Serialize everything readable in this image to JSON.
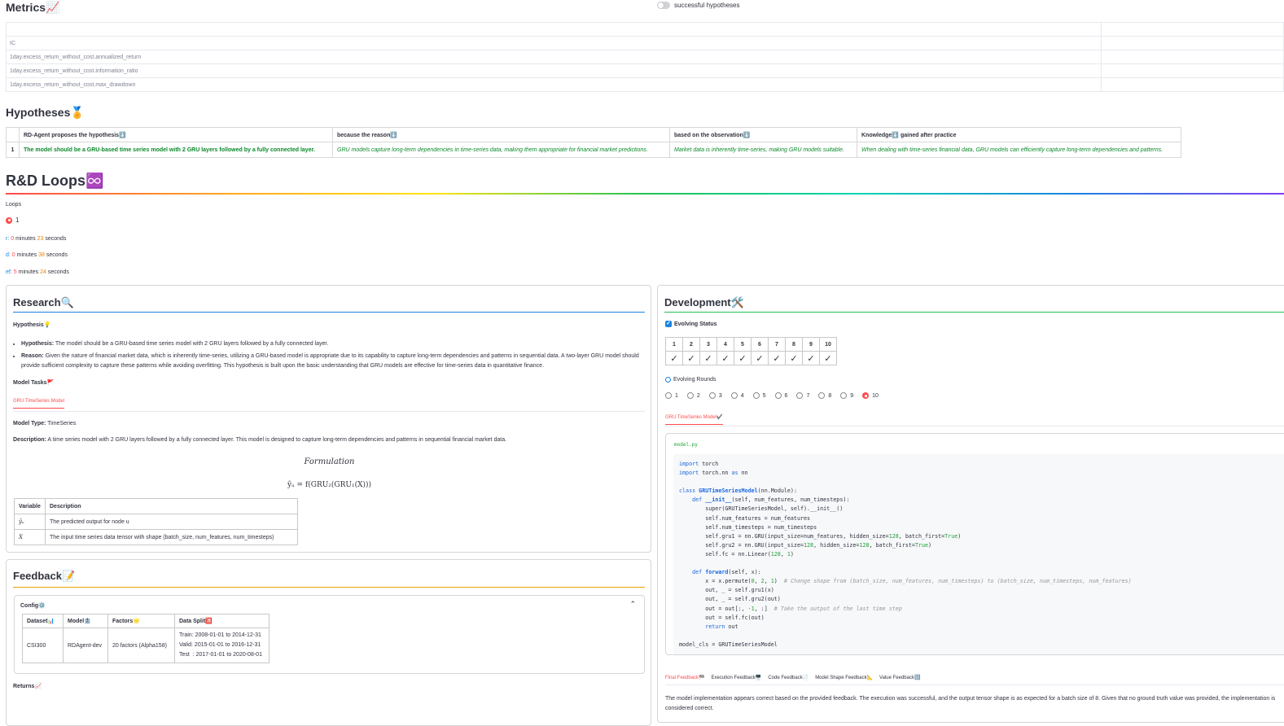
{
  "metrics": {
    "title": "Metrics📈",
    "toggle_label": "successful hypotheses",
    "rows": [
      "",
      "IC",
      "1day.excess_return_without_cost.annualized_return",
      "1day.excess_return_without_cost.information_ratio",
      "1day.excess_return_without_cost.max_drawdown"
    ]
  },
  "hypotheses": {
    "title": "Hypotheses🏅",
    "headers": [
      "",
      "RD-Agent proposes the hypothesis⬇️",
      "because the reason⬇️",
      "based on the observation⬇️",
      "Knowledge⬇️ gained after practice"
    ],
    "row": {
      "index": "1",
      "hypothesis": "The model should be a GRU-based time series model with 2 GRU layers followed by a fully connected layer.",
      "reason": "GRU models capture long-term dependencies in time-series data, making them appropriate for financial market predictions.",
      "observation": "Market data is inherently time-series, making GRU models suitable.",
      "knowledge": "When dealing with time-series financial data, GRU models can efficiently capture long-term dependencies and patterns."
    }
  },
  "rd": {
    "title": "R&D Loops♾️",
    "loops_label": "Loops",
    "loop_value": "1",
    "timings": [
      {
        "key": "r:",
        "min": "0",
        "sec": "23"
      },
      {
        "key": "d:",
        "min": "0",
        "sec": "38"
      },
      {
        "key": "ef:",
        "min": "5",
        "sec": "24"
      }
    ],
    "minutes_word": "minutes",
    "seconds_word": "seconds"
  },
  "research": {
    "title": "Research🔍",
    "hypothesis_label": "Hypothesis💡",
    "bullet1_key": "Hypothesis:",
    "bullet1_text": "The model should be a GRU-based time series model with 2 GRU layers followed by a fully connected layer.",
    "bullet2_key": "Reason:",
    "bullet2_text": "Given the nature of financial market data, which is inherently time-series, utilizing a GRU-based model is appropriate due to its capability to capture long-term dependencies and patterns in sequential data. A two-layer GRU model should provide sufficient complexity to capture these patterns while avoiding overfitting. This hypothesis is built upon the basic understanding that GRU models are effective for time-series data in quantitative finance.",
    "tasks_label": "Model Tasks🚩",
    "task_tab": "GRU TimeSeries Model",
    "model_type_key": "Model Type:",
    "model_type": "TimeSeries",
    "description_key": "Description:",
    "description": "A time series model with 2 GRU layers followed by a fully connected layer. This model is designed to capture long-term dependencies and patterns in sequential financial market data.",
    "formulation_title": "Formulation",
    "formula": "ŷᵤ = f(GRU₂(GRU₁(X)))",
    "var_headers": [
      "Variable",
      "Description"
    ],
    "variables": [
      {
        "v": "ŷᵤ",
        "d": "The predicted output for node u"
      },
      {
        "v": "X",
        "d": "The input time series data tensor with shape (batch_size, num_features, num_timesteps)"
      }
    ]
  },
  "feedback": {
    "title": "Feedback📝",
    "config_label": "Config⚙️",
    "headers": [
      "Dataset📊",
      "Model🏦",
      "Factors🌟",
      "Data Split🈵"
    ],
    "dataset": "CSI300",
    "model": "RDAgent-dev",
    "factors": "20 factors (Alpha158)",
    "split": [
      "Train: 2008-01-01 to 2014-12-31",
      "Valid: 2015-01-01 to 2016-12-31",
      "Test  : 2017-01-01 to 2020-08-01"
    ],
    "returns_label": "Returns📈"
  },
  "development": {
    "title": "Development🛠️",
    "evolving_status": "Evolving Status",
    "rounds": [
      "1",
      "2",
      "3",
      "4",
      "5",
      "6",
      "7",
      "8",
      "9",
      "10"
    ],
    "check": "✓",
    "evolving_rounds": "Evolving Rounds",
    "selected_round": "10",
    "task_tab": "GRU TimeSeries Model✔️",
    "file_name": "model.py",
    "feedback_tabs": [
      "Final Feedback🏁",
      "Execution Feedback🖥️",
      "Code Feedback📄",
      "Model Shape Feedback📐",
      "Value Feedback🔢"
    ],
    "final_feedback": "The model implementation appears correct based on the provided feedback. The execution was successful, and the output tensor shape is as expected for a batch size of 8. Given that no ground truth value was provided, the implementation is considered correct."
  },
  "colors": {
    "accent_red": "#ff4b4b",
    "link_blue": "#1c83e1",
    "hypothesis_green": "#098a2a"
  }
}
